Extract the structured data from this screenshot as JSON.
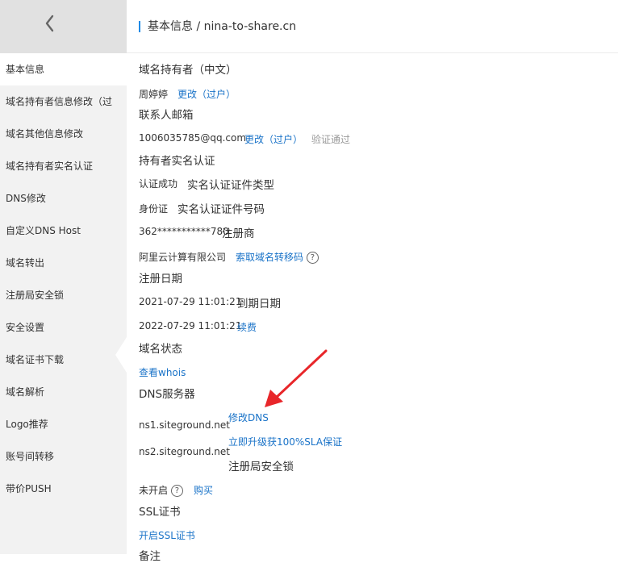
{
  "header": {
    "title": "基本信息 / nina-to-share.cn"
  },
  "sidebar": {
    "items": [
      {
        "label": "基本信息"
      },
      {
        "label": "域名持有者信息修改（过"
      },
      {
        "label": "域名其他信息修改"
      },
      {
        "label": "域名持有者实名认证"
      },
      {
        "label": "DNS修改"
      },
      {
        "label": "自定义DNS Host"
      },
      {
        "label": "域名转出"
      },
      {
        "label": "注册局安全锁"
      },
      {
        "label": "安全设置"
      },
      {
        "label": "域名证书下载"
      },
      {
        "label": "域名解析"
      },
      {
        "label": "Logo推荐"
      },
      {
        "label": "账号间转移"
      },
      {
        "label": "带价PUSH"
      }
    ]
  },
  "main": {
    "owner_cn_label": "域名持有者（中文）",
    "owner_name": "周婷婷",
    "owner_edit": "更改（过户）",
    "email_label": "联系人邮箱",
    "email": "1006035785@qq.com",
    "email_edit": "更改（过户）",
    "email_status": "验证通过",
    "realname_label": "持有者实名认证",
    "realname_status": "认证成功",
    "id_type_label": "实名认证证件类型",
    "id_type": "身份证",
    "id_no_label": "实名认证证件号码",
    "id_no": "362***********780",
    "registrar_label": "注册商",
    "registrar": "阿里云计算有限公司",
    "transfer_code_link": "索取域名转移码",
    "reg_date_label": "注册日期",
    "reg_date": "2021-07-29 11:01:21",
    "exp_date_label": "到期日期",
    "exp_date": "2022-07-29 11:01:21",
    "renew_link": "续费",
    "status_label": "域名状态",
    "whois_link": "查看whois",
    "dns_label": "DNS服务器",
    "ns1": "ns1.siteground.net",
    "ns2": "ns2.siteground.net",
    "modify_dns_link": "修改DNS",
    "sla_link": "立即升级获100%SLA保证",
    "lock_label": "注册局安全锁",
    "lock_status": "未开启",
    "buy_link": "购买",
    "ssl_label": "SSL证书",
    "ssl_link": "开启SSL证书",
    "remark_label": "备注",
    "help_glyph": "?"
  },
  "annotation": {
    "arrow_color": "#e8262a"
  }
}
